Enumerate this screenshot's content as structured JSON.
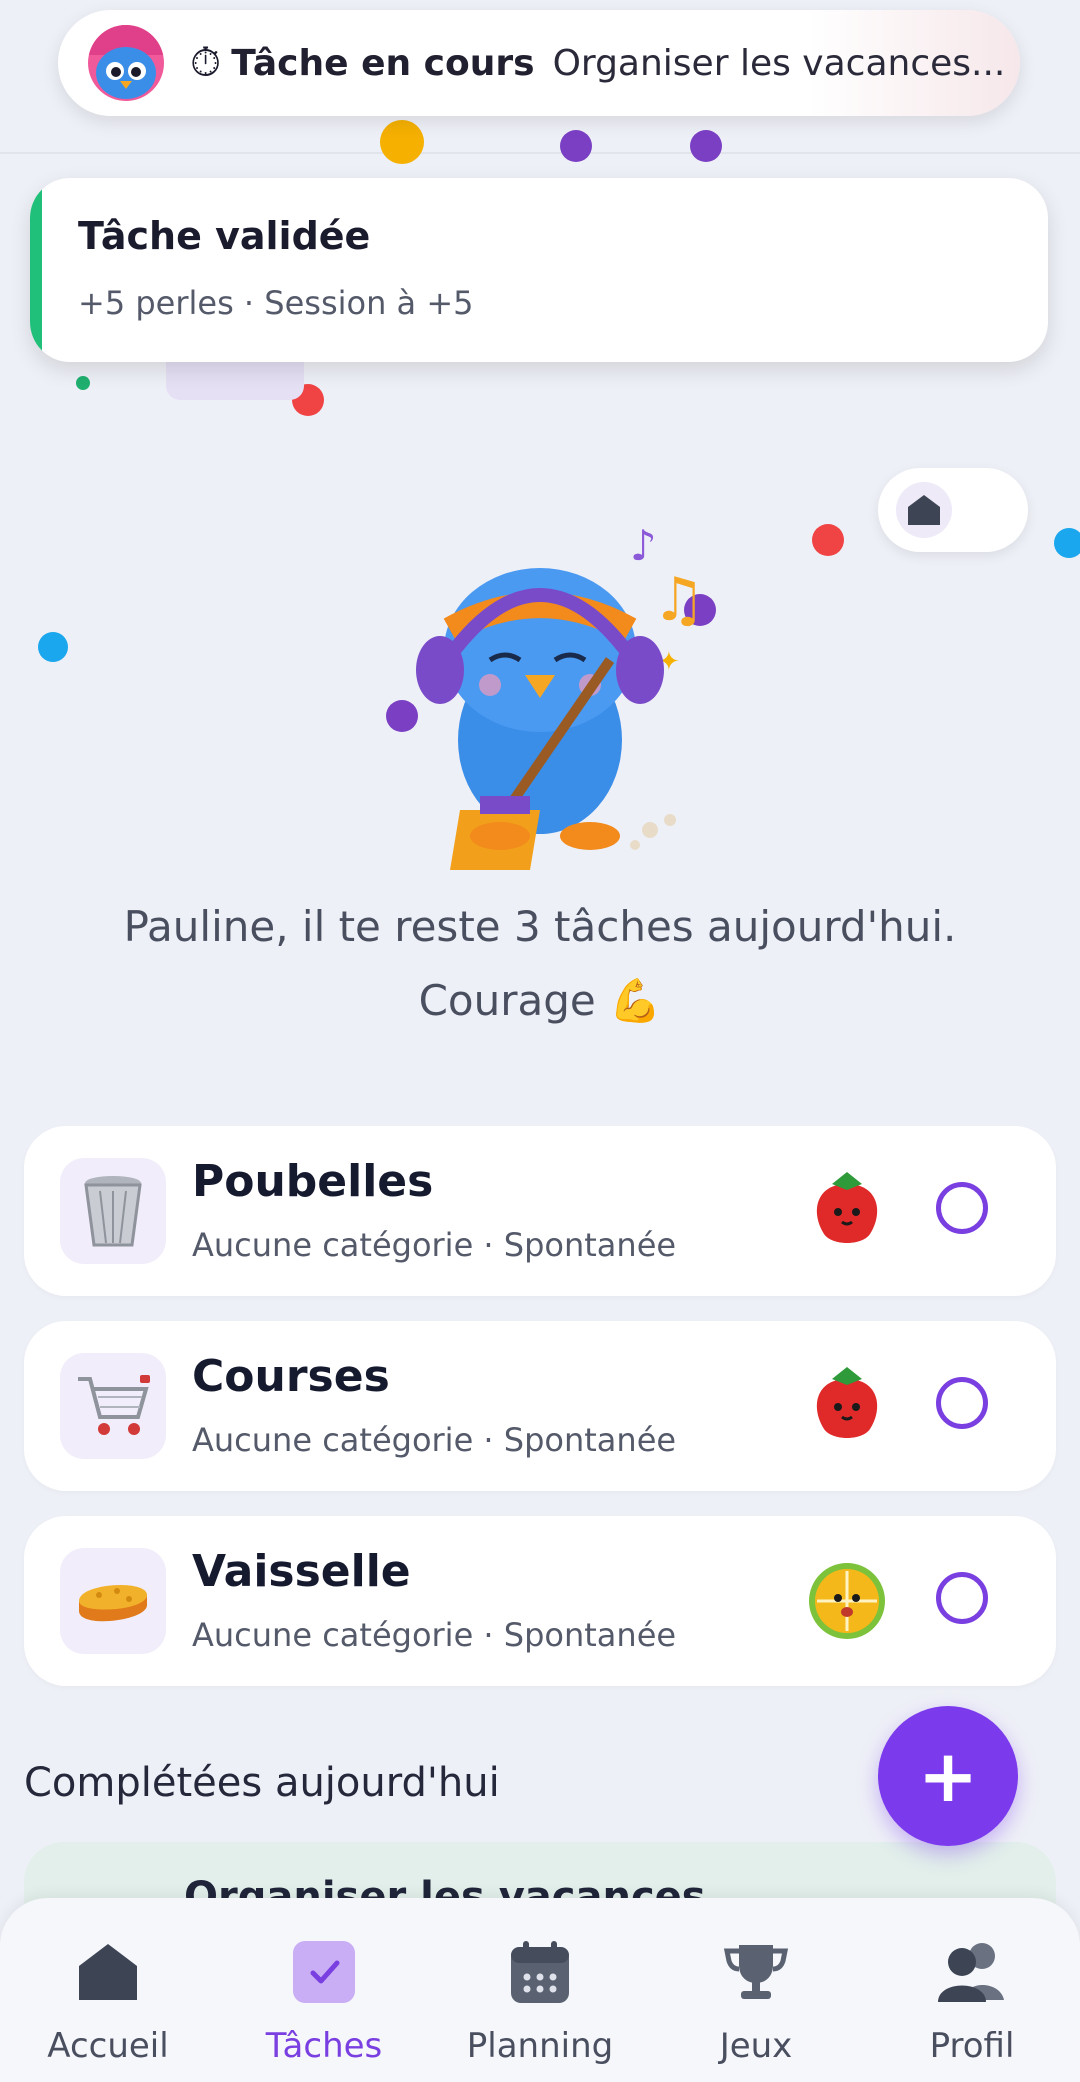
{
  "top_banner": {
    "clock_icon": "stopwatch-icon",
    "title": "Tâche en cours",
    "task": "Organiser les vacances..."
  },
  "toast": {
    "title": "Tâche validée",
    "subtitle": "+5 perles · Session à +5",
    "accent_color": "#20c07a"
  },
  "message": {
    "line1": "Pauline, il te reste 3 tâches aujourd'hui.",
    "line2": "Courage 💪"
  },
  "tasks": [
    {
      "name": "Poubelles",
      "meta": "Aucune catégorie · Spontanée",
      "icon": "trash-bin-icon",
      "badge": "strawberry-icon"
    },
    {
      "name": "Courses",
      "meta": "Aucune catégorie · Spontanée",
      "icon": "shopping-cart-icon",
      "badge": "strawberry-icon"
    },
    {
      "name": "Vaisselle",
      "meta": "Aucune catégorie · Spontanée",
      "icon": "sponge-icon",
      "badge": "lemon-icon"
    }
  ],
  "completed": {
    "title": "Complétées aujourd'hui",
    "first_item": "Organiser les vacances"
  },
  "fab": {
    "label": "+"
  },
  "nav": {
    "items": [
      {
        "label": "Accueil",
        "icon": "home-icon"
      },
      {
        "label": "Tâches",
        "icon": "tasks-check-icon"
      },
      {
        "label": "Planning",
        "icon": "calendar-icon"
      },
      {
        "label": "Jeux",
        "icon": "trophy-icon"
      },
      {
        "label": "Profil",
        "icon": "users-icon"
      }
    ],
    "active": "Tâches",
    "active_color": "#7a3fe0"
  }
}
